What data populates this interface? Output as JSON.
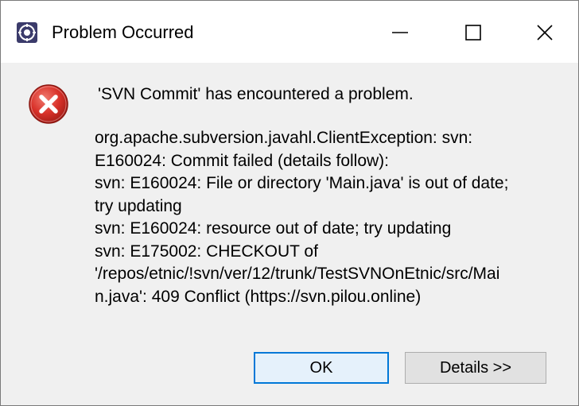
{
  "window": {
    "title": "Problem Occurred",
    "app_icon": "eclipse-icon",
    "controls": {
      "minimize_icon": "minimize-icon",
      "maximize_icon": "maximize-icon",
      "close_icon": "close-icon"
    }
  },
  "dialog": {
    "icon": "error-icon",
    "headline": "'SVN Commit' has encountered a problem.",
    "message_lines": [
      "org.apache.subversion.javahl.ClientException: svn:",
      "E160024: Commit failed (details follow):",
      "svn: E160024: File or directory 'Main.java' is out of date;",
      "try updating",
      "svn: E160024: resource out of date; try updating",
      "svn: E175002: CHECKOUT of",
      "'/repos/etnic/!svn/ver/12/trunk/TestSVNOnEtnic/src/Mai",
      "n.java': 409 Conflict (https://svn.pilou.online)"
    ]
  },
  "buttons": {
    "ok_label": "OK",
    "details_label": "Details >>"
  },
  "colors": {
    "error_red": "#d9322a",
    "default_button_border": "#0078d7"
  }
}
